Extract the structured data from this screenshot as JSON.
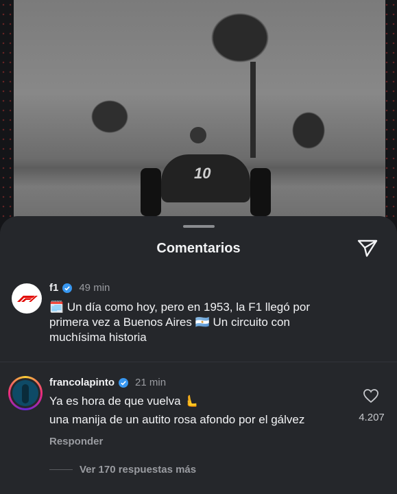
{
  "sheet": {
    "title": "Comentarios"
  },
  "caption": {
    "username": "f1",
    "time": "49 min",
    "emoji_start": "🗓️",
    "line1": "Un día como hoy, pero en 1953, la F1 llegó por",
    "line2_a": "primera vez a Buenos Aires",
    "flag": "🇦🇷",
    "line2_b": "Un circuito con",
    "line3": "muchísima historia"
  },
  "comment": {
    "username": "francolapinto",
    "time": "21 min",
    "line1": "Ya es hora de que vuelva",
    "hand": "🫷",
    "line2": "una manija de un autito rosa afondo por el gálvez",
    "likes": "4.207",
    "reply_label": "Responder",
    "view_replies": "Ver 170 respuestas más"
  },
  "photo": {
    "car_number": "10"
  },
  "colors": {
    "sheet_bg": "#25272b",
    "verified": "#3897f0",
    "f1_red": "#e10600"
  }
}
